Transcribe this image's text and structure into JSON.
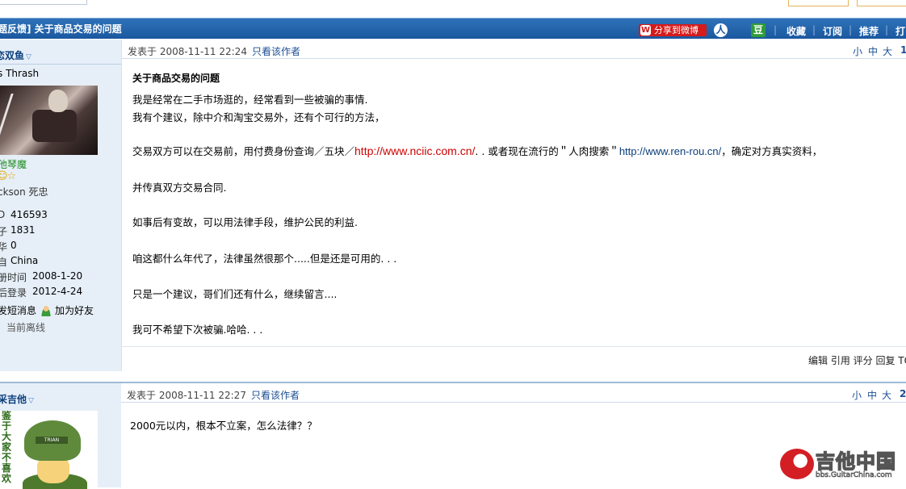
{
  "thread": {
    "title": "题反馈] 关于商品交易的问题",
    "share_button": "分享到微博",
    "person_icon": "人",
    "douban_icon": "豆",
    "actions": [
      "收藏",
      "订阅",
      "推荐",
      "打"
    ]
  },
  "post1": {
    "user": {
      "name": "恋双鱼",
      "title": "s Thrash",
      "rank": "他琴魔",
      "stars": "☺☆",
      "extra": "ckson 死忠",
      "stats": [
        {
          "label": "D",
          "value": "416593"
        },
        {
          "label": "子",
          "value": "1831"
        },
        {
          "label": "华",
          "value": "0"
        },
        {
          "label": "自",
          "value": "China"
        },
        {
          "label": "册时间",
          "value": "2008-1-20"
        },
        {
          "label": "后登录",
          "value": "2012-4-24"
        }
      ],
      "send_message": "发短消息",
      "add_friend": "加为好友",
      "status": "当前离线"
    },
    "header": {
      "posted": "发表于 2008-11-11 22:24",
      "author_only": "只看该作者",
      "font_small": "小",
      "font_medium": "中",
      "font_large": "大",
      "floor": "1"
    },
    "title": "关于商品交易的问题",
    "lines": {
      "l1": "我是经常在二手市场逛的，经常看到一些被骗的事情.",
      "l2": "我有个建议，除中介和淘宝交易外，还有个可行的方法，",
      "l3a": "交易双方可以在交易前，用付费身份查询／五块／",
      "l3link": "http://www.nciic.com.cn/",
      "l3b": ". . 或者现在流行的＂人肉搜索＂",
      "l3link2": "http://www.ren-rou.cn/",
      "l3c": "，确定对方真实资料，",
      "l4": "并传真双方交易合同.",
      "l5": "如事后有变故，可以用法律手段，维护公民的利益.",
      "l6": "咱这都什么年代了，法律虽然很那个.....但是还是可用的. . .",
      "l7": "只是一个建议，哥们们还有什么，继续留言....",
      "l8": "我可不希望下次被骗.哈哈. . ."
    },
    "footer_ops": "编辑 引用 评分 回复 TO"
  },
  "post2": {
    "user": {
      "name": "采吉他",
      "avatar_text": "鉴于大家不喜欢",
      "avatar_band": "TRIAN"
    },
    "header": {
      "posted": "发表于 2008-11-11 22:27",
      "author_only": "只看该作者",
      "font_small": "小",
      "font_medium": "中",
      "font_large": "大",
      "floor": "2"
    },
    "line1": "2000元以内，根本不立案，怎么法律？？"
  },
  "watermark": {
    "text": "吉他中国",
    "url": "bbs.GuitarChina.com"
  }
}
